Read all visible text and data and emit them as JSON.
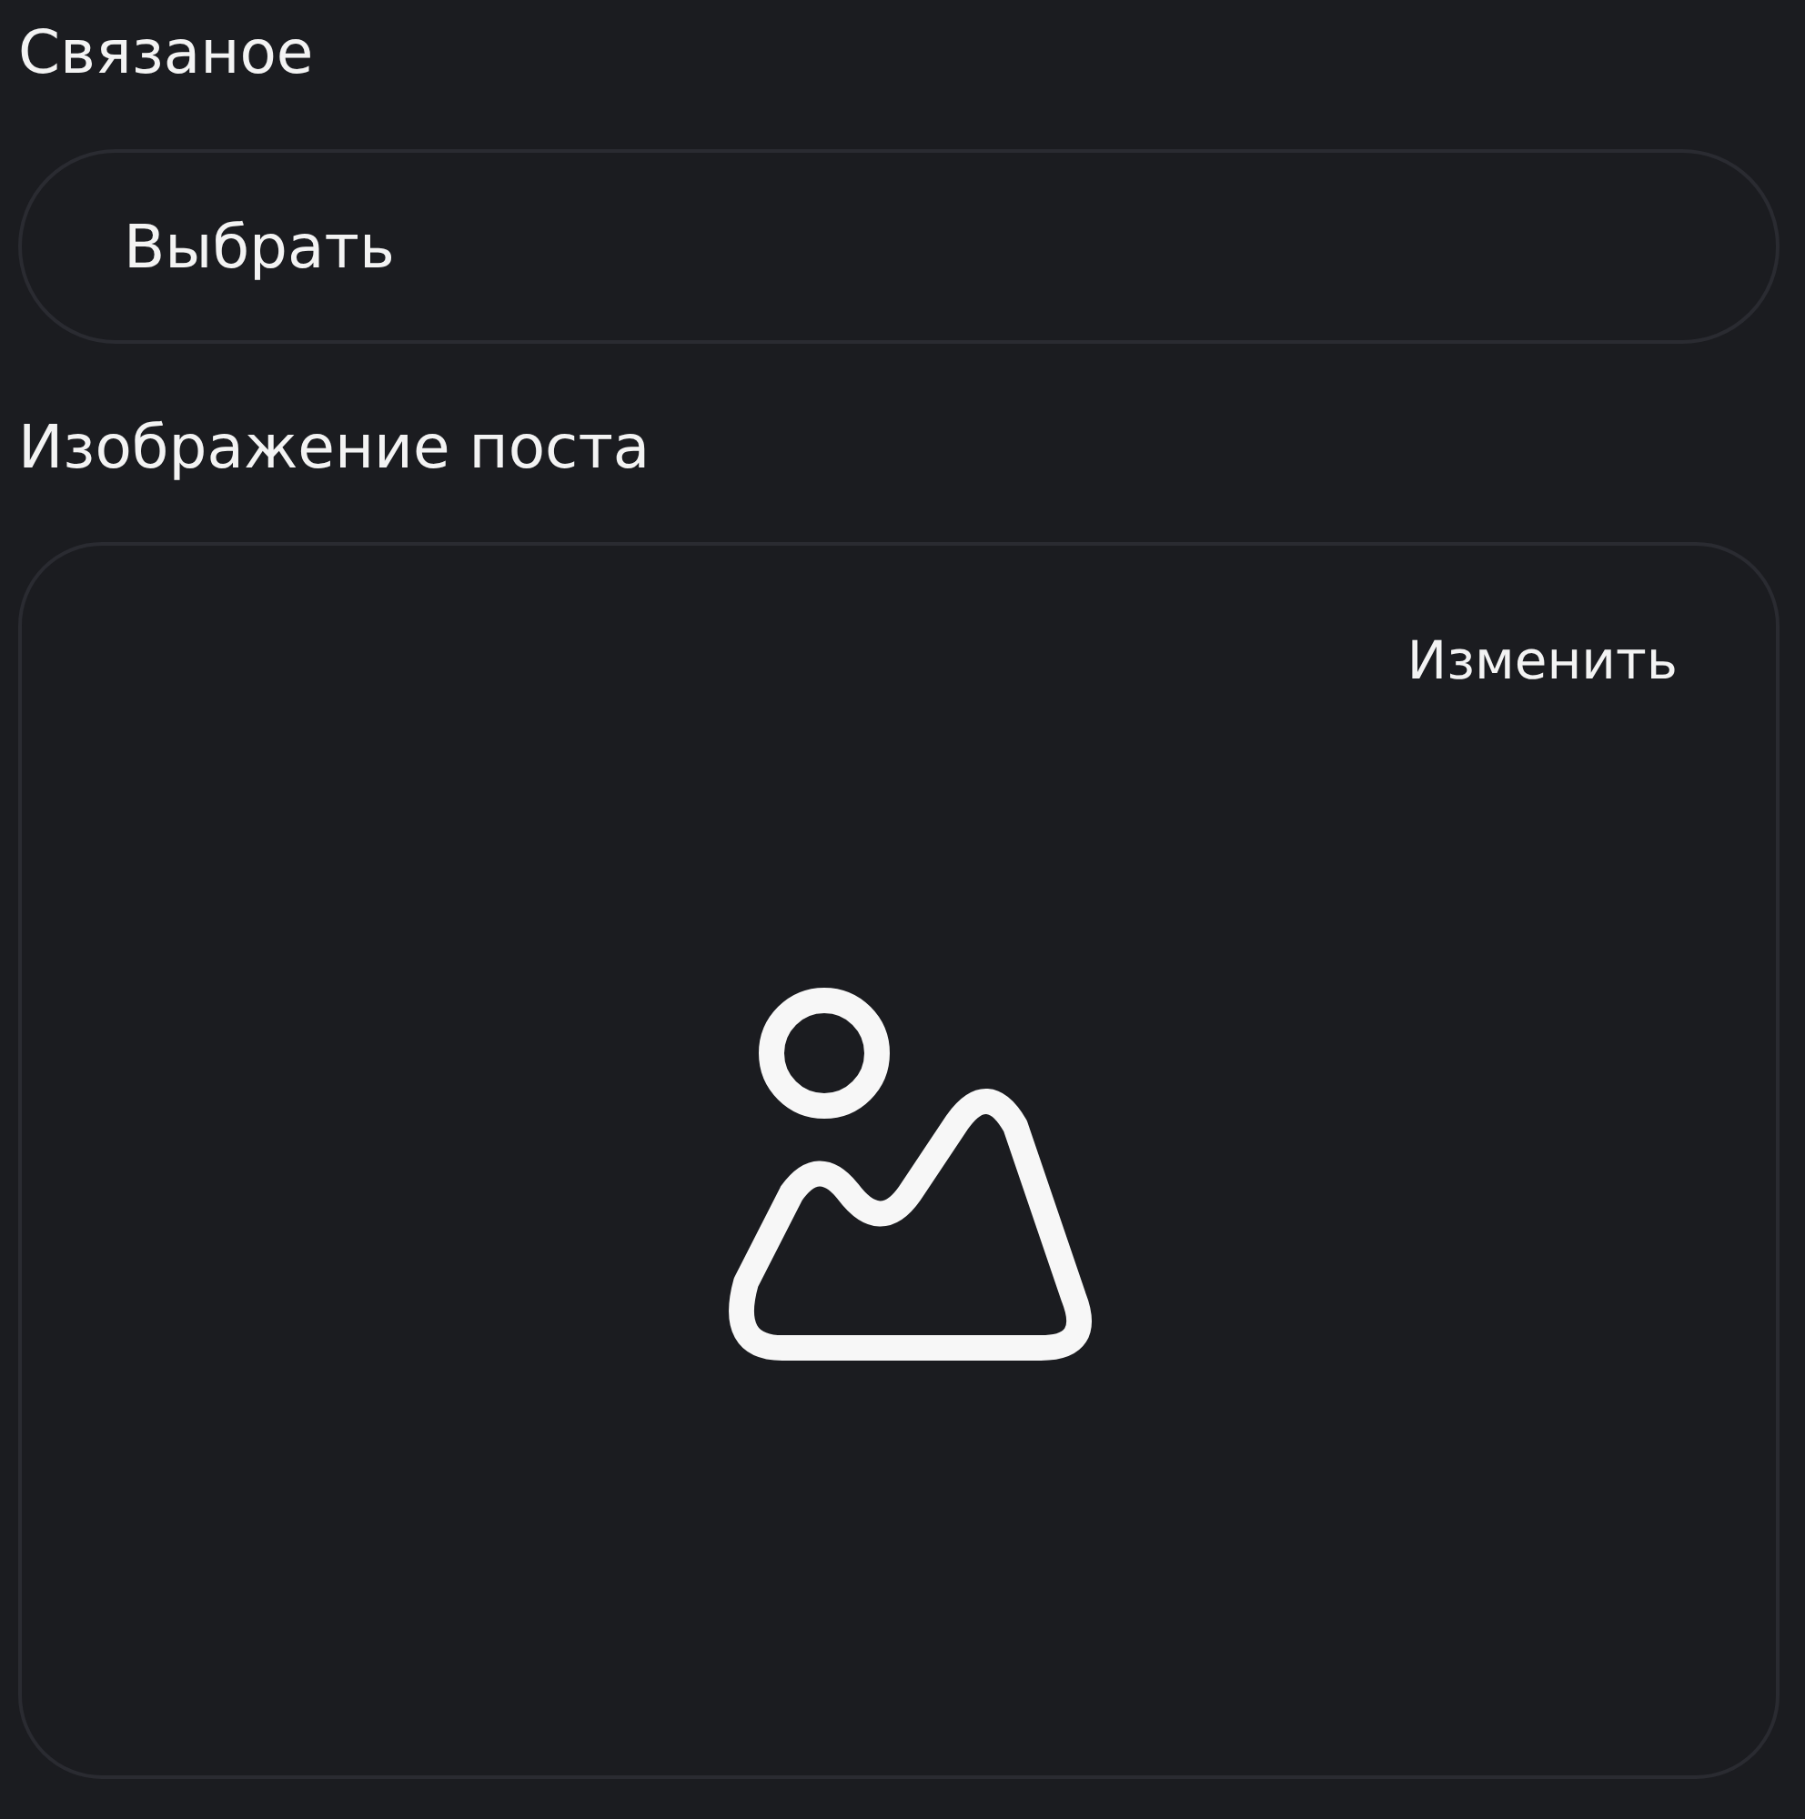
{
  "related": {
    "label": "Связаное",
    "select_label": "Выбрать"
  },
  "post_image": {
    "label": "Изображение поста",
    "change_label": "Изменить"
  }
}
